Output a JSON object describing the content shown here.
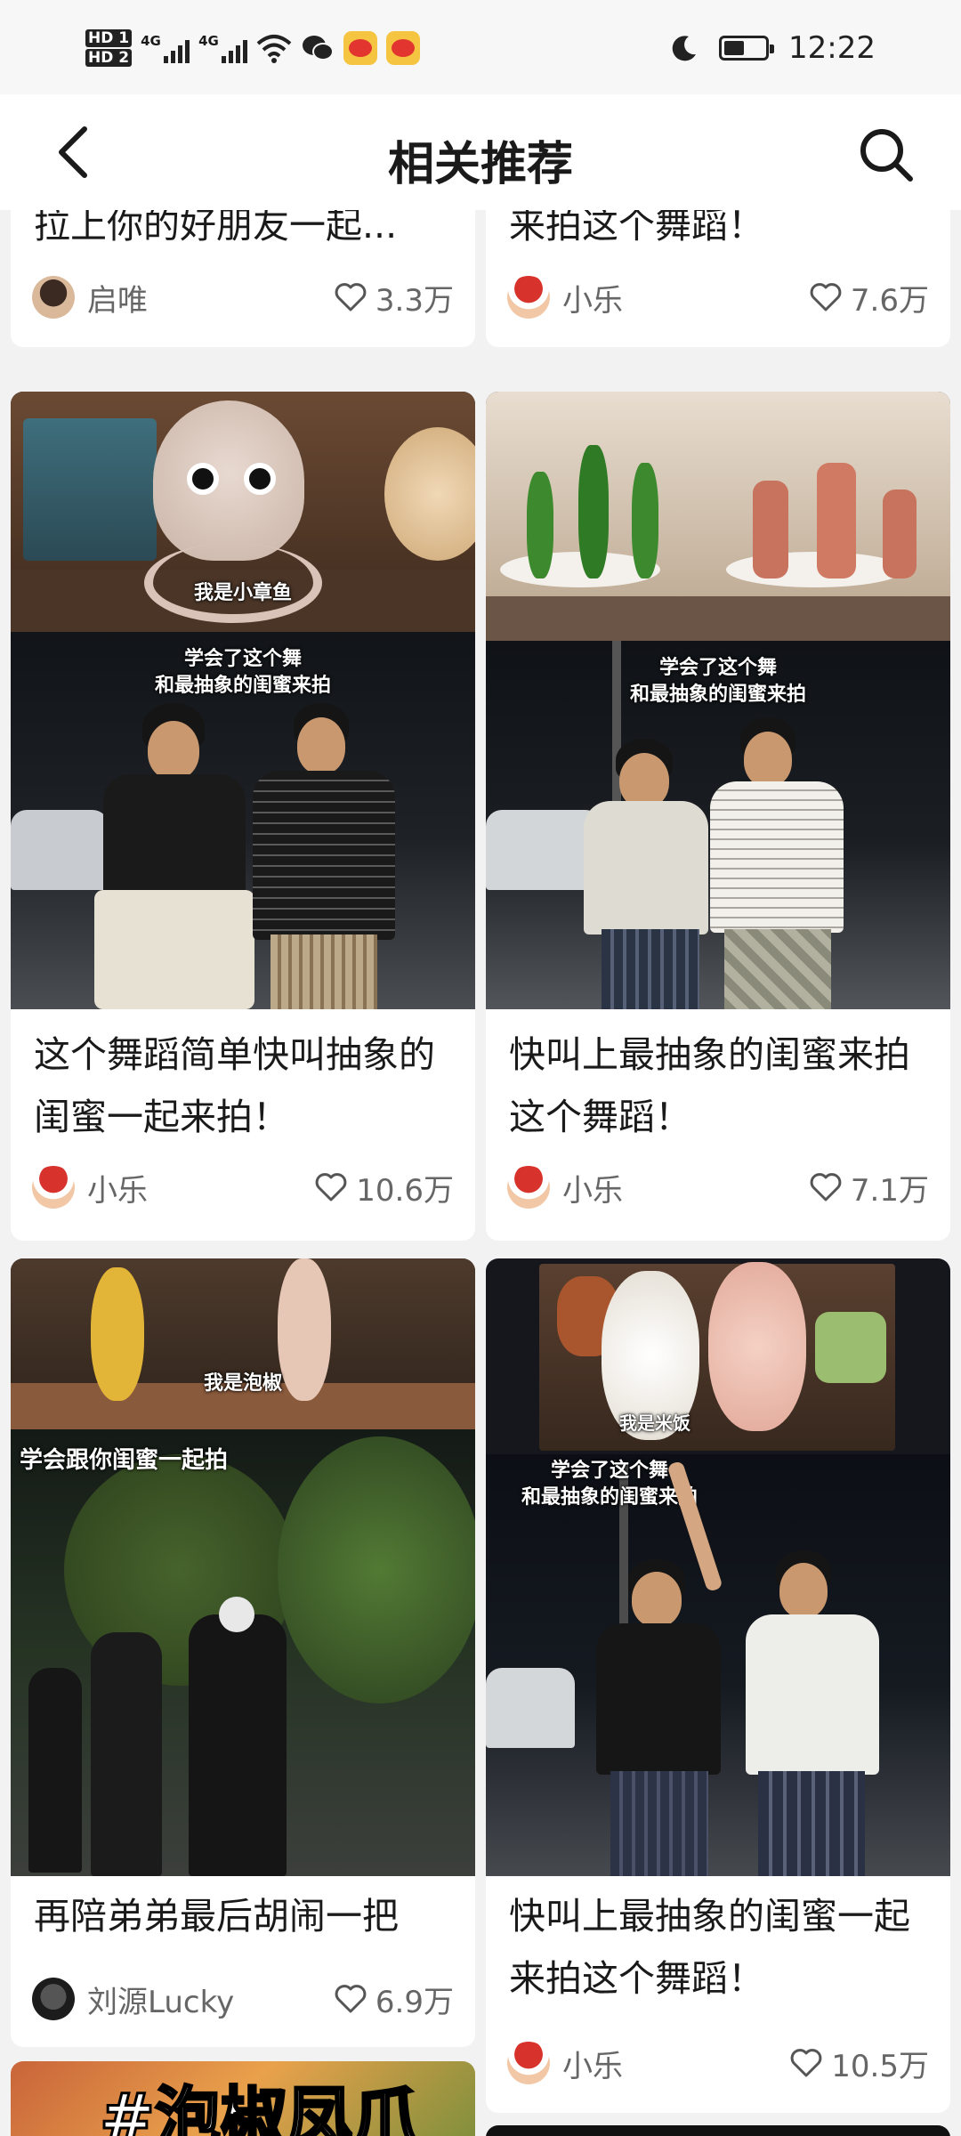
{
  "status_bar": {
    "sim1": "HD 1",
    "sim2": "HD 2",
    "network1": "4G",
    "network2": "4G",
    "time": "12:22"
  },
  "nav": {
    "title": "相关推荐"
  },
  "cards": [
    {
      "title": "拉上你的好朋友一起...",
      "author": "启唯",
      "likes": "3.3万"
    },
    {
      "title": "来拍这个舞蹈！",
      "author": "小乐",
      "likes": "7.6万"
    },
    {
      "title": "这个舞蹈简单快叫抽象的闺蜜一起来拍！",
      "author": "小乐",
      "likes": "10.6万",
      "caption_top": "我是小章鱼",
      "caption_bottom_1": "学会了这个舞",
      "caption_bottom_2": "和最抽象的闺蜜来拍"
    },
    {
      "title": "快叫上最抽象的闺蜜来拍这个舞蹈！",
      "author": "小乐",
      "likes": "7.1万",
      "caption_bottom_1": "学会了这个舞",
      "caption_bottom_2": "和最抽象的闺蜜来拍"
    },
    {
      "title": "再陪弟弟最后胡闹一把",
      "author": "刘源Lucky",
      "likes": "6.9万",
      "caption_top": "我是泡椒",
      "caption_bottom_1": "学会跟你闺蜜一起拍"
    },
    {
      "title": "快叫上最抽象的闺蜜一起来拍这个舞蹈！",
      "author": "小乐",
      "likes": "10.5万",
      "caption_top": "我是米饭",
      "caption_bottom_1": "学会了这个舞",
      "caption_bottom_2": "和最抽象的闺蜜来拍"
    },
    {
      "overlay_text": "#泡椒凤爪"
    }
  ]
}
